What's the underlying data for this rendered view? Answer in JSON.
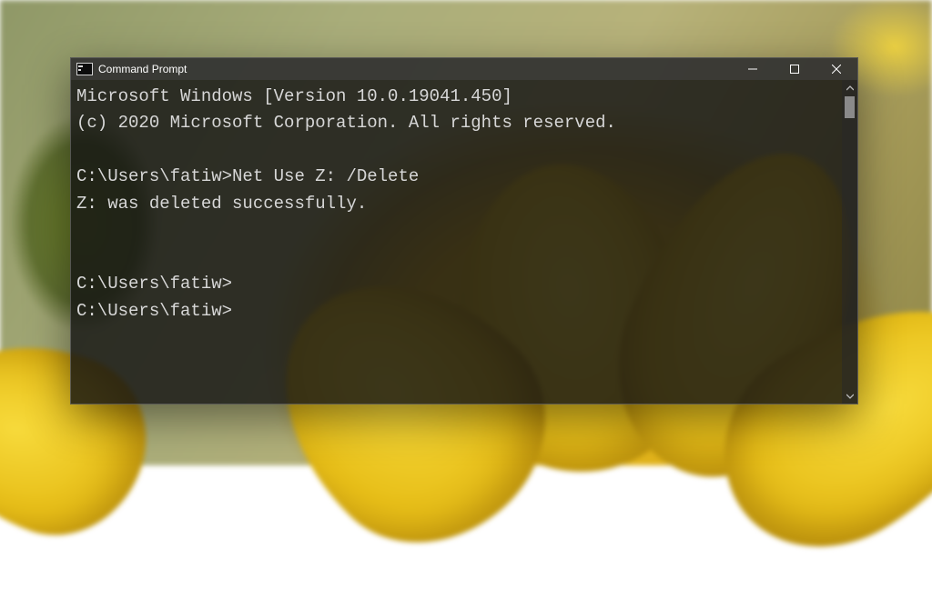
{
  "window": {
    "title": "Command Prompt"
  },
  "terminal": {
    "lines": [
      "Microsoft Windows [Version 10.0.19041.450]",
      "(c) 2020 Microsoft Corporation. All rights reserved.",
      "",
      "C:\\Users\\fatiw>Net Use Z: /Delete",
      "Z: was deleted successfully.",
      "",
      "",
      "C:\\Users\\fatiw>",
      "C:\\Users\\fatiw>"
    ]
  }
}
